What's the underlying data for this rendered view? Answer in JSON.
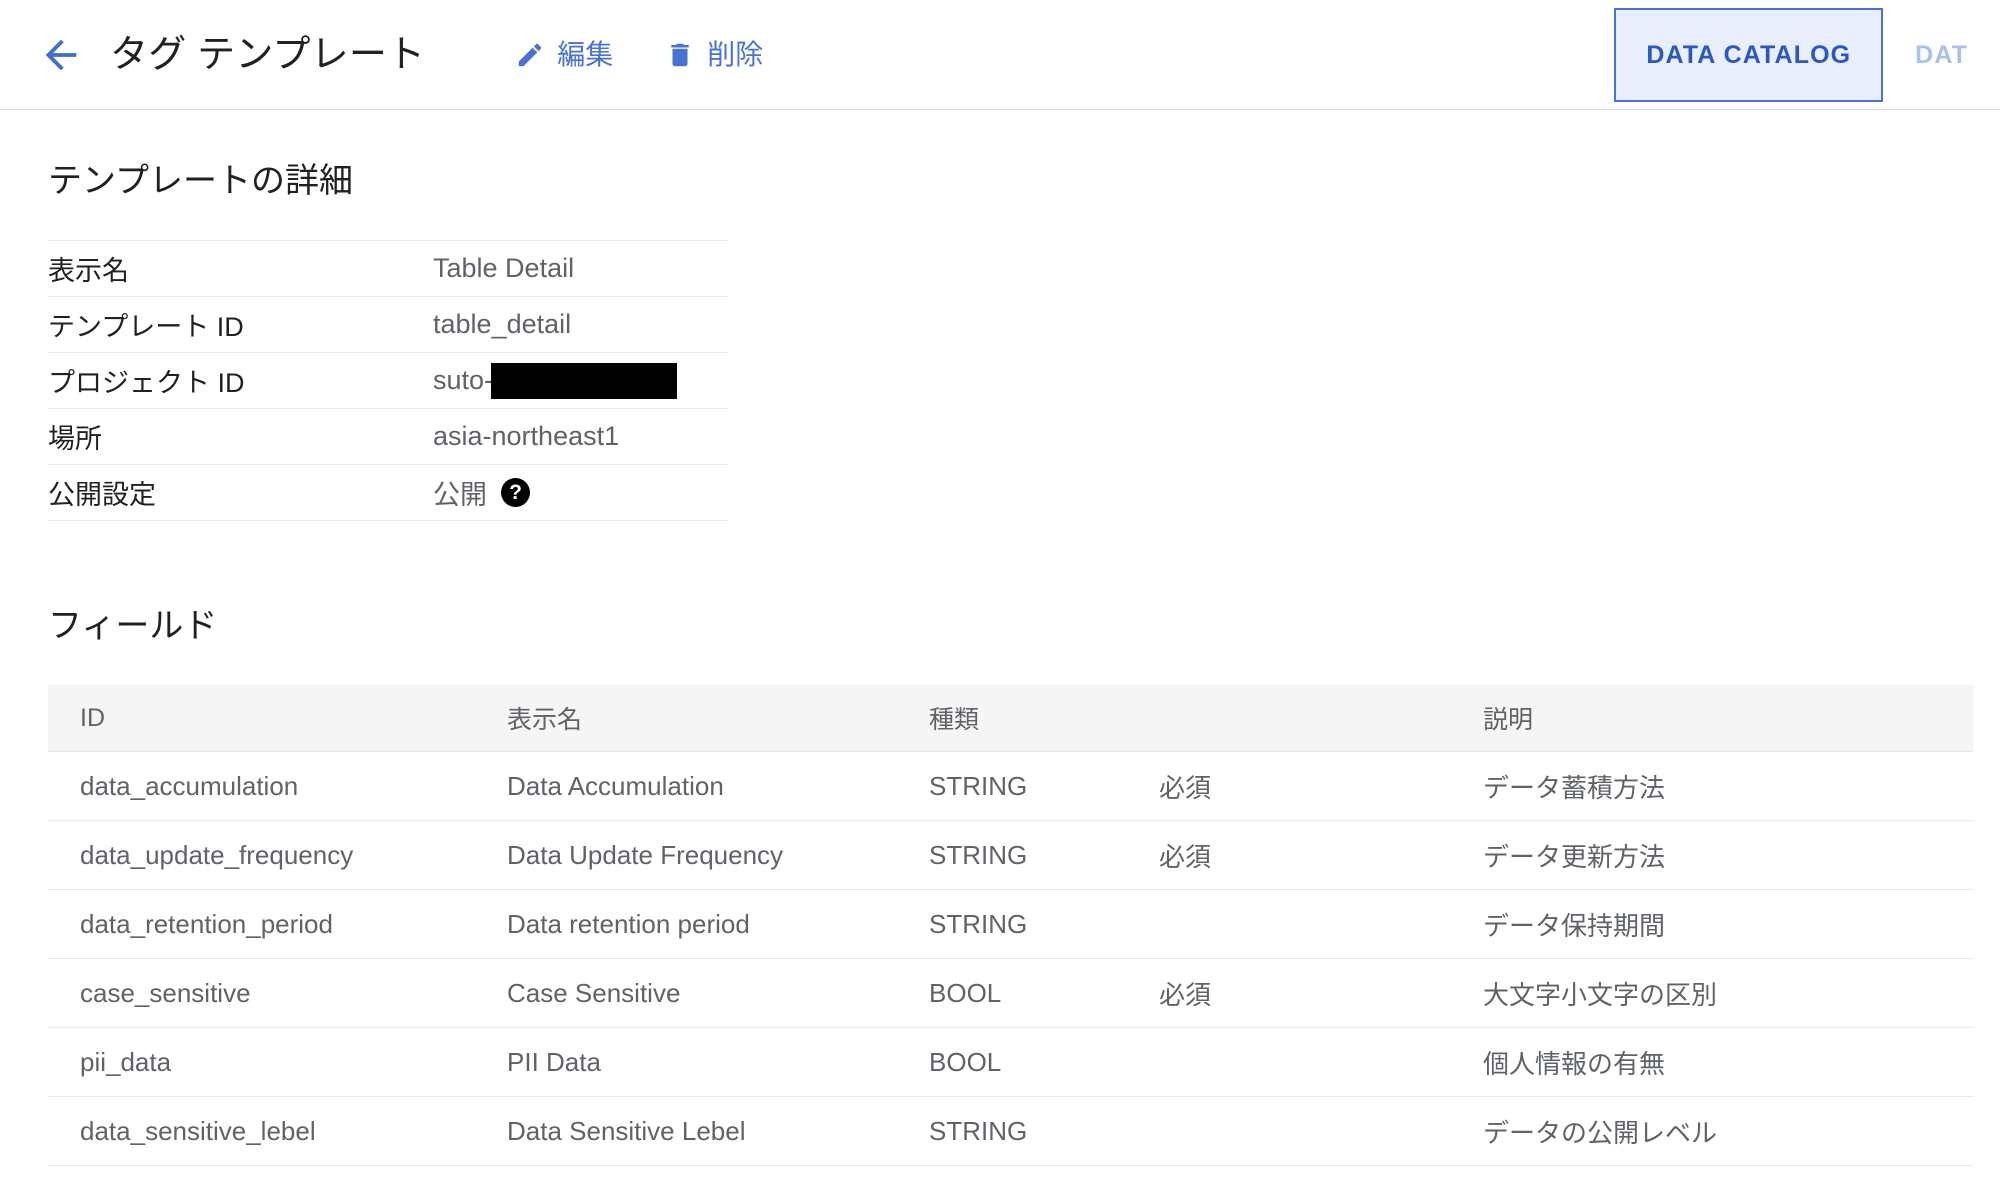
{
  "header": {
    "back_icon": "arrow-left-icon",
    "title": "タグ テンプレート",
    "edit": {
      "icon": "pencil-icon",
      "label": "編集"
    },
    "delete": {
      "icon": "trash-icon",
      "label": "削除"
    },
    "tabs": [
      {
        "label": "DATA CATALOG",
        "active": true
      },
      {
        "label": "DAT",
        "active": false
      }
    ]
  },
  "details": {
    "heading": "テンプレートの詳細",
    "rows": [
      {
        "key": "表示名",
        "value": "Table Detail",
        "redacted": false,
        "help": false
      },
      {
        "key": "テンプレート ID",
        "value": "table_detail",
        "redacted": false,
        "help": false
      },
      {
        "key": "プロジェクト ID",
        "value": "suto-",
        "redacted": true,
        "help": false
      },
      {
        "key": "場所",
        "value": "asia-northeast1",
        "redacted": false,
        "help": false
      },
      {
        "key": "公開設定",
        "value": "公開",
        "redacted": false,
        "help": true,
        "help_glyph": "?"
      }
    ]
  },
  "fields": {
    "heading": "フィールド",
    "columns": [
      "ID",
      "表示名",
      "種類",
      "",
      "説明"
    ],
    "rows": [
      {
        "id": "data_accumulation",
        "display_name": "Data Accumulation",
        "type": "STRING",
        "required": "必須",
        "description": "データ蓄積方法"
      },
      {
        "id": "data_update_frequency",
        "display_name": "Data Update Frequency",
        "type": "STRING",
        "required": "必須",
        "description": "データ更新方法"
      },
      {
        "id": "data_retention_period",
        "display_name": "Data retention period",
        "type": "STRING",
        "required": "",
        "description": "データ保持期間"
      },
      {
        "id": "case_sensitive",
        "display_name": "Case Sensitive",
        "type": "BOOL",
        "required": "必須",
        "description": "大文字小文字の区別"
      },
      {
        "id": "pii_data",
        "display_name": "PII Data",
        "type": "BOOL",
        "required": "",
        "description": "個人情報の有無"
      },
      {
        "id": "data_sensitive_lebel",
        "display_name": "Data Sensitive Lebel",
        "type": "STRING",
        "required": "",
        "description": "データの公開レベル"
      }
    ]
  },
  "colors": {
    "accent_blue": "#4a72d6",
    "tab_active_text": "#2a56c6",
    "tab_active_bg": "#e8eefc",
    "tab_inactive_text": "#a8c0f0",
    "text_primary": "#202124",
    "text_secondary": "#5f6368",
    "table_header_bg": "#f5f5f5",
    "divider": "#e5e7e9"
  }
}
